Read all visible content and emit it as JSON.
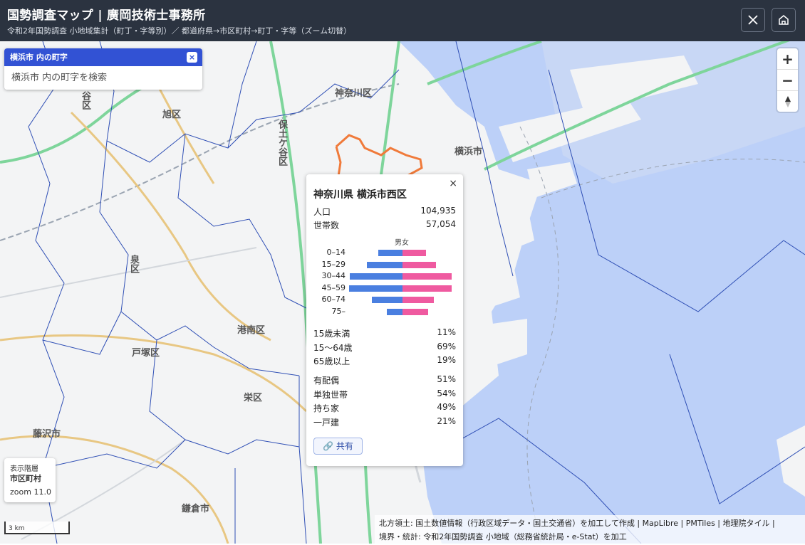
{
  "header": {
    "title": "国勢調査マップ | 廣岡技術士事務所",
    "subtitle": "令和2年国勢調査 小地域集計（町丁・字等別）／ 都道府県→市区町村→町丁・字等（ズーム切替）",
    "x_button": "x-social",
    "home_button": "home"
  },
  "search": {
    "title": "横浜市 内の町字",
    "close": "×",
    "placeholder": "横浜市 内の町字を検索"
  },
  "zoom_controls": {
    "zoom_in": "+",
    "zoom_out": "−"
  },
  "map_labels": [
    "旭区",
    "泉区",
    "戸塚区",
    "港南区",
    "栄区",
    "藤沢市",
    "鎌倉市",
    "保土ケ谷区",
    "神奈川区",
    "横浜市",
    "谷区"
  ],
  "popup": {
    "close": "×",
    "title": "神奈川県 横浜市西区",
    "population_label": "人口",
    "population_value": "104,935",
    "households_label": "世帯数",
    "households_value": "57,054",
    "pyramid_header": "男女",
    "pyramid": [
      {
        "age": "0–14",
        "male": 34,
        "female": 33
      },
      {
        "age": "15–29",
        "male": 50,
        "female": 47
      },
      {
        "age": "30–44",
        "male": 74,
        "female": 69
      },
      {
        "age": "45–59",
        "male": 75,
        "female": 69
      },
      {
        "age": "60–74",
        "male": 43,
        "female": 44
      },
      {
        "age": "75–",
        "male": 22,
        "female": 36
      }
    ],
    "age_stats": [
      {
        "label": "15歳未満",
        "value": "11%"
      },
      {
        "label": "15〜64歳",
        "value": "69%"
      },
      {
        "label": "65歳以上",
        "value": "19%"
      }
    ],
    "house_stats": [
      {
        "label": "有配偶",
        "value": "51%"
      },
      {
        "label": "単独世帯",
        "value": "54%"
      },
      {
        "label": "持ち家",
        "value": "49%"
      },
      {
        "label": "一戸建",
        "value": "21%"
      }
    ],
    "share_label": "🔗 共有"
  },
  "layer_info": {
    "label": "表示階層",
    "level": "市区町村",
    "zoom": "zoom 11.0"
  },
  "scale": "3 km",
  "attribution": {
    "line1": "北方領土: 国土数値情報（行政区域データ・国土交通省）を加工して作成 | MapLibre | PMTiles | 地理院タイル |",
    "line2": "境界・統計: 令和2年国勢調査 小地域（総務省統計局・e-Stat）を加工"
  }
}
